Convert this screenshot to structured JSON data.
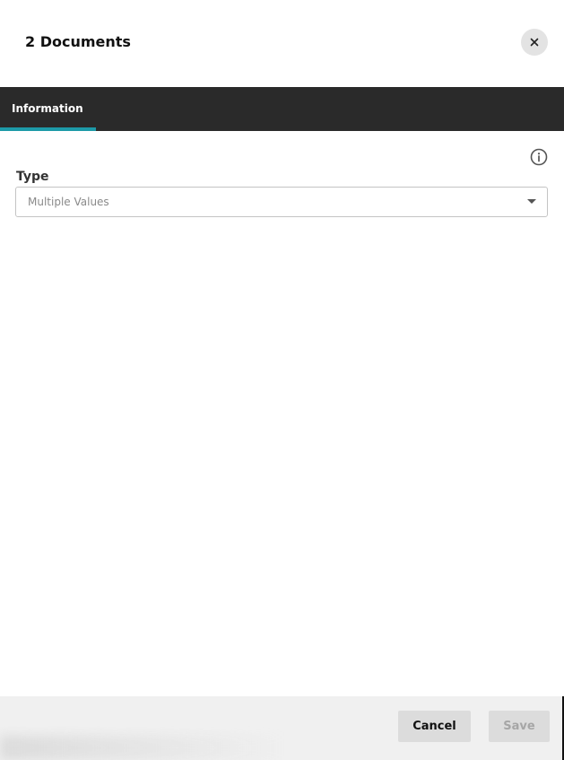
{
  "dialog": {
    "title": "2 Documents",
    "close_icon": "close-icon"
  },
  "tabs": [
    {
      "label": "Information",
      "active": true
    }
  ],
  "colors": {
    "tab_bar_bg": "#2a2a2a",
    "tab_active_indicator": "#1d9aa8",
    "footer_bg": "#f0f0f0"
  },
  "form": {
    "info_icon": "info-icon",
    "type_field": {
      "label": "Type",
      "value": "Multiple Values",
      "caret_icon": "caret-down-icon"
    }
  },
  "footer": {
    "cancel_label": "Cancel",
    "save_label": "Save",
    "save_disabled": true
  }
}
